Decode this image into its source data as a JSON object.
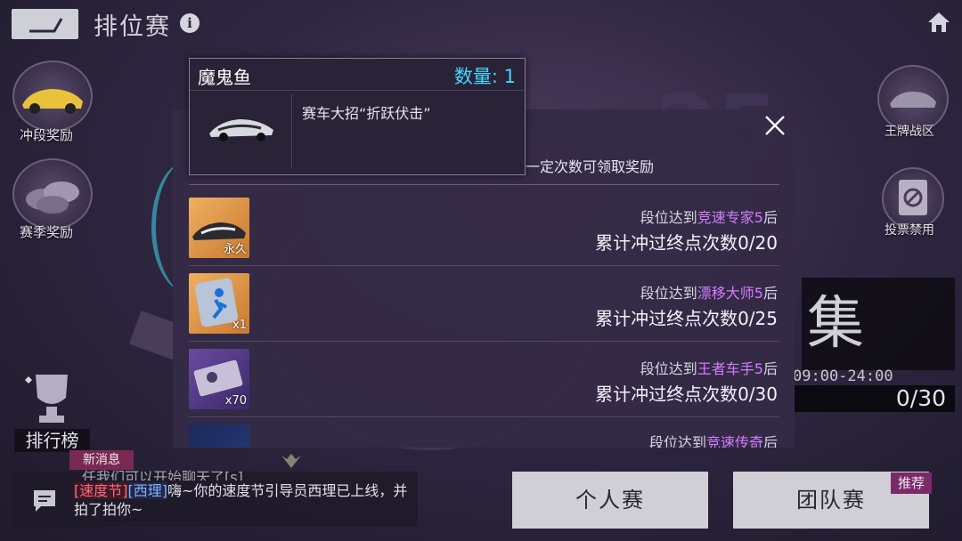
{
  "header": {
    "title": "排位赛"
  },
  "side_left": [
    {
      "label": "冲段奖励"
    },
    {
      "label": "赛季奖励"
    },
    {
      "label": "排行榜"
    }
  ],
  "side_right": [
    {
      "label": "王牌战区"
    },
    {
      "label": "投票禁用"
    }
  ],
  "background": {
    "big_char": "集",
    "time_text": "09:00-24:00",
    "progress_text": "0/30"
  },
  "modal": {
    "hint": "一定次数可领取奖励",
    "rewards": [
      {
        "thumb_label": "永久",
        "req_prefix": "段位达到",
        "rank": "竞速专家5",
        "req_suffix": "后",
        "count": "累计冲过终点次数0/20"
      },
      {
        "thumb_label": "x1",
        "req_prefix": "段位达到",
        "rank": "漂移大师5",
        "req_suffix": "后",
        "count": "累计冲过终点次数0/25"
      },
      {
        "thumb_label": "x70",
        "req_prefix": "段位达到",
        "rank": "王者车手5",
        "req_suffix": "后",
        "count": "累计冲过终点次数0/30"
      },
      {
        "thumb_label": "",
        "req_prefix": "段位达到",
        "rank": "竞速传奇",
        "req_suffix": "后",
        "count": ""
      }
    ]
  },
  "tooltip": {
    "name": "魔鬼鱼",
    "qty_label": "数量: ",
    "qty_value": "1",
    "description": "赛车大招“折跃伏击”"
  },
  "chat": {
    "new_msg_tag": "新消息",
    "line1_partial": "任我们可以开始聊天了[s]",
    "tag1": "[速度节]",
    "tag2": "[西理]",
    "message": "嗨~你的速度节引导员西理已上线，并拍了拍你~"
  },
  "buttons": {
    "solo": "个人赛",
    "team": "团队赛",
    "recommend_tag": "推荐"
  },
  "colors": {
    "accent_cyan": "#43d8ff",
    "rank_purple": "#d37cff"
  }
}
